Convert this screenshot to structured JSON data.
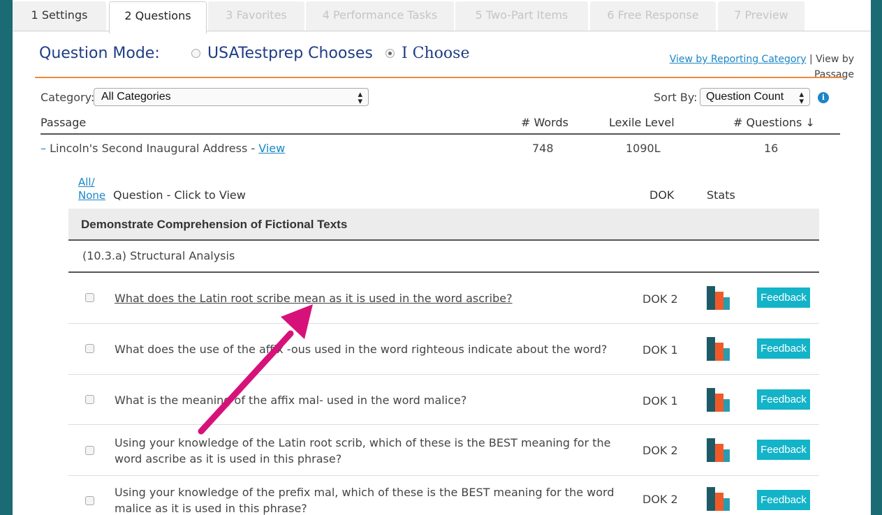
{
  "tabs": [
    {
      "label": "1 Settings",
      "state": "normal"
    },
    {
      "label": "2 Questions",
      "state": "active"
    },
    {
      "label": "3 Favorites",
      "state": "disabled"
    },
    {
      "label": "4 Performance Tasks",
      "state": "disabled"
    },
    {
      "label": "5 Two-Part Items",
      "state": "disabled"
    },
    {
      "label": "6 Free Response",
      "state": "disabled"
    },
    {
      "label": "7 Preview",
      "state": "disabled"
    }
  ],
  "mode": {
    "label": "Question Mode:",
    "options": [
      "USATestprep Chooses",
      "I Choose"
    ],
    "selected": "I Choose"
  },
  "view_links": {
    "by_category": "View by Reporting Category",
    "separator": "|",
    "by_passage": "View by Passage"
  },
  "filters": {
    "category_label": "Category:",
    "category_value": "All Categories",
    "sort_label": "Sort By:",
    "sort_value": "Question Count"
  },
  "passage_table": {
    "headers": {
      "passage": "Passage",
      "words": "# Words",
      "lexile": "Lexile Level",
      "questions": "# Questions ↓"
    },
    "row": {
      "collapse": "–",
      "title": "Lincoln's Second Inaugural Address - ",
      "view": "View",
      "words": "748",
      "lexile": "1090L",
      "questions": "16"
    }
  },
  "questions_header": {
    "all": "All/",
    "none": "None",
    "question": "Question - Click to View",
    "dok": "DOK",
    "stats": "Stats"
  },
  "category": "Demonstrate Comprehension of Fictional Texts",
  "subcategory": "(10.3.a) Structural Analysis",
  "feedback_label": "Feedback",
  "questions": [
    {
      "text": "What does the Latin root scribe mean as it is used in the word ascribe?",
      "dok": "DOK 2"
    },
    {
      "text": "What does the use of the affix -ous used in the word righteous indicate about the word?",
      "dok": "DOK 1"
    },
    {
      "text": "What is the meaning of the affix mal- used in the word malice?",
      "dok": "DOK 1"
    },
    {
      "text": "Using your knowledge of the Latin root scrib, which of these is the BEST meaning for the word ascribe as it is used in this phrase?",
      "dok": "DOK 2"
    },
    {
      "text": "Using your knowledge of the prefix mal, which of these is the BEST meaning for the word malice as it is used in this phrase?",
      "dok": "DOK 2"
    }
  ],
  "colors": {
    "page_bg": "#1b6b74",
    "heading_blue": "#1f3d86",
    "link_blue": "#1a86c7",
    "orange_rule": "#f28a3c",
    "feedback_btn": "#13b3c8",
    "arrow": "#d6127a"
  }
}
